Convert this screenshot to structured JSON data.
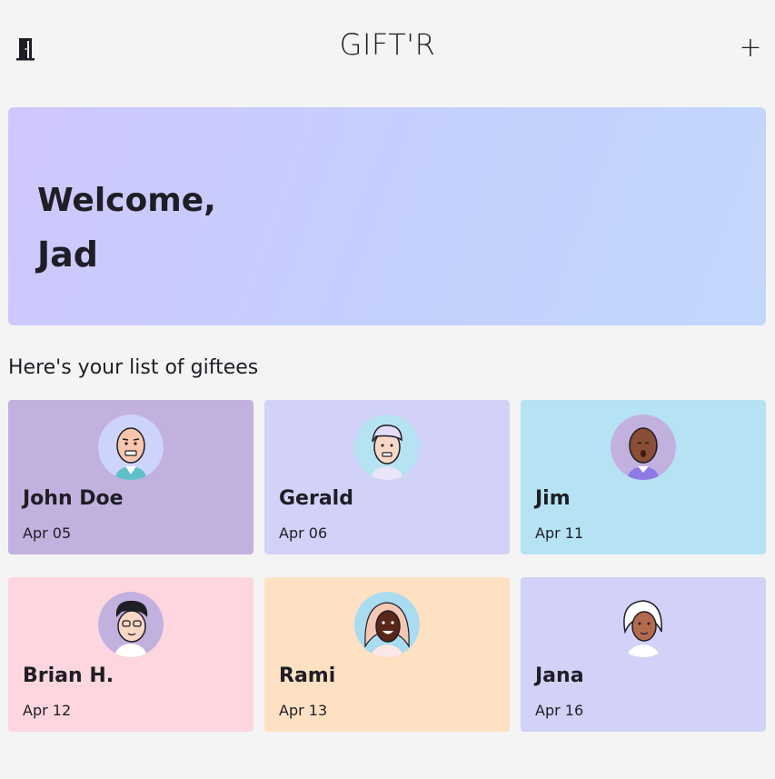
{
  "header": {
    "title": "GIFT'R",
    "logout_icon": "door-icon",
    "add_label": "+"
  },
  "welcome": {
    "line1": "Welcome,",
    "line2": "Jad"
  },
  "section": {
    "title": "Here's your list of giftees"
  },
  "giftees": [
    {
      "name": "John Doe",
      "date": "Apr 05",
      "card_color": "#c2b0df",
      "avatar_bg": "#cdd4fb"
    },
    {
      "name": "Gerald",
      "date": "Apr 06",
      "card_color": "#d2d2f8",
      "avatar_bg": "#b6e3f2"
    },
    {
      "name": "Jim",
      "date": "Apr 11",
      "card_color": "#b5e3f3",
      "avatar_bg": "#c2b0df"
    },
    {
      "name": "Brian H.",
      "date": "Apr 12",
      "card_color": "#fed6df",
      "avatar_bg": "#c2b0df"
    },
    {
      "name": "Rami",
      "date": "Apr 13",
      "card_color": "#fee0c2",
      "avatar_bg": "#a9dcf0"
    },
    {
      "name": "Jana",
      "date": "Apr 16",
      "card_color": "#d2d2f8",
      "avatar_bg": "#d2d2f8"
    }
  ]
}
